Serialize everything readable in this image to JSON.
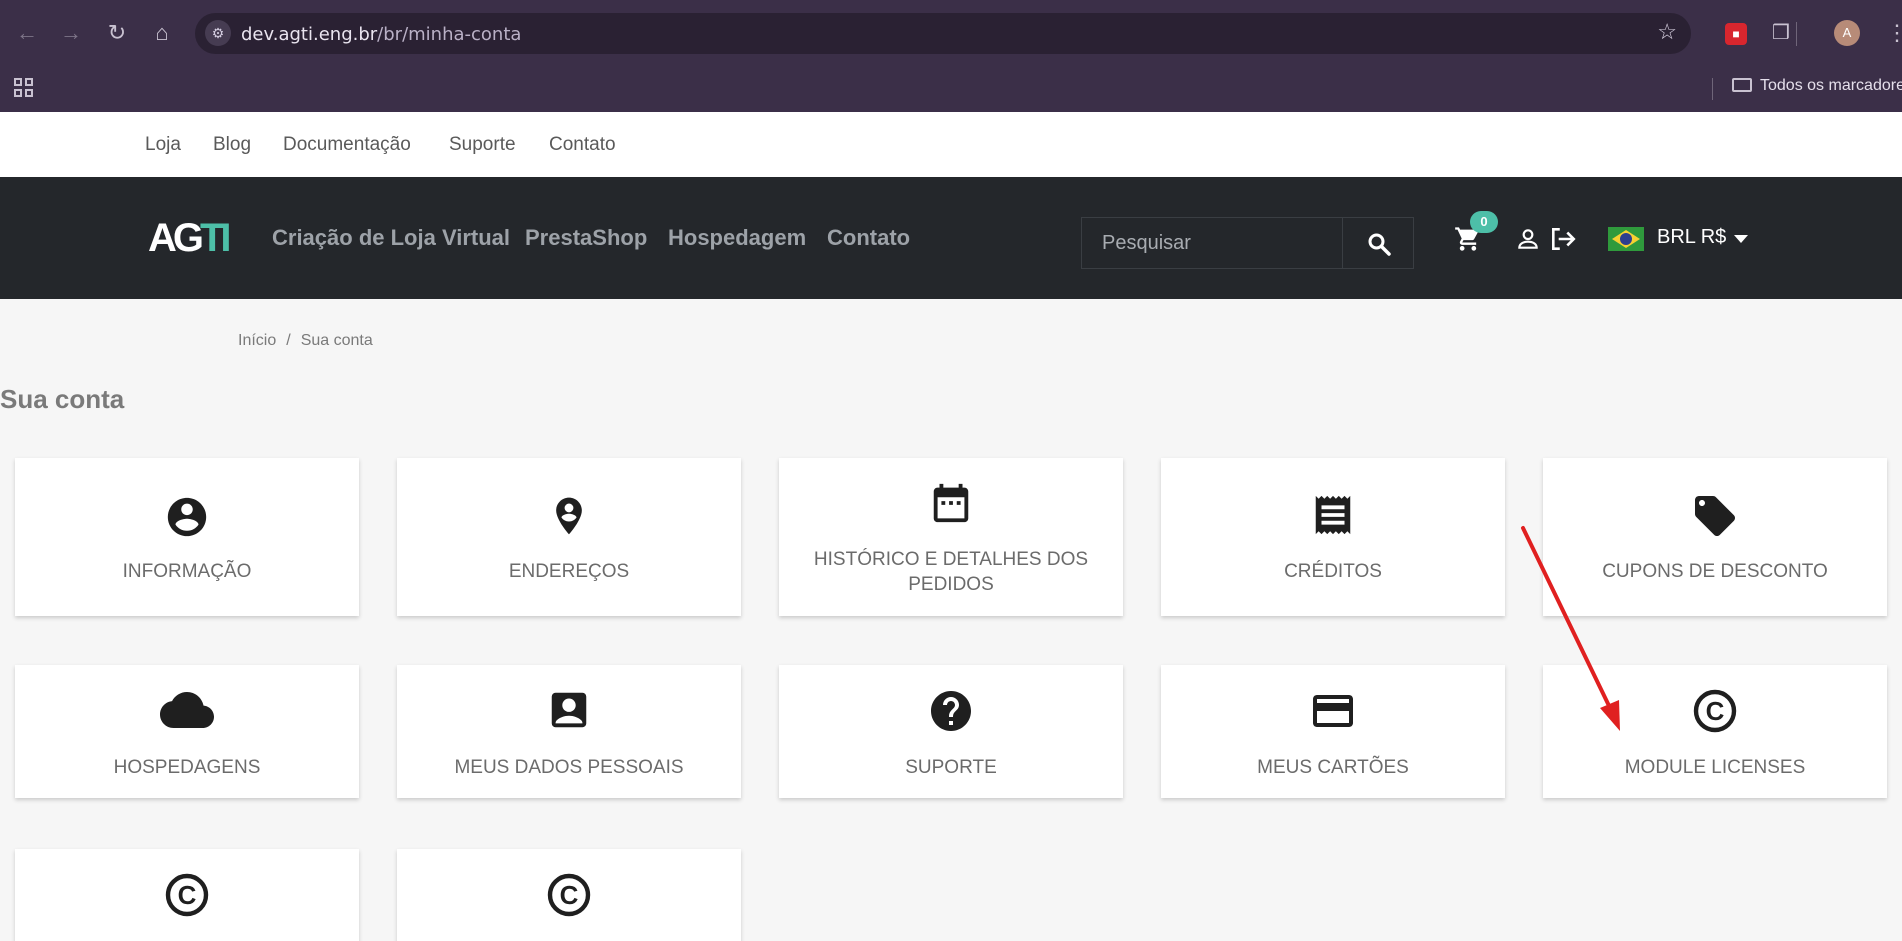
{
  "browser": {
    "url_domain": "dev.agti.eng.br",
    "url_path": "/br/minha-conta",
    "avatar_letter": "A",
    "bookmarks_folder": "Todos os marcadores",
    "icons": [
      "back-icon",
      "forward-icon",
      "reload-icon",
      "home-icon",
      "site-settings-icon",
      "star-icon",
      "extension-icon",
      "puzzle-icon",
      "kebab-menu-icon",
      "apps-grid-icon",
      "folder-icon"
    ]
  },
  "top_links": [
    "Loja",
    "Blog",
    "Documentação",
    "Suporte",
    "Contato"
  ],
  "header": {
    "logo_white": "AG",
    "logo_green": "TI",
    "nav": [
      "Criação de Loja Virtual",
      "PrestaShop",
      "Hospedagem",
      "Contato"
    ],
    "search_placeholder": "Pesquisar",
    "cart_count": "0",
    "currency": "BRL R$",
    "accent": "#4dbfa8"
  },
  "breadcrumb": [
    "Início",
    "/",
    "Sua conta"
  ],
  "page_title": "Sua conta",
  "cards": [
    {
      "label": "INFORMAÇÃO",
      "icon": "account-circle-icon"
    },
    {
      "label": "ENDEREÇOS",
      "icon": "location-pin-icon"
    },
    {
      "label": "HISTÓRICO E DETALHES DOS PEDIDOS",
      "icon": "calendar-icon"
    },
    {
      "label": "CRÉDITOS",
      "icon": "receipt-icon"
    },
    {
      "label": "CUPONS DE DESCONTO",
      "icon": "tag-icon"
    },
    {
      "label": "HOSPEDAGENS",
      "icon": "cloud-icon"
    },
    {
      "label": "MEUS DADOS PESSOAIS",
      "icon": "contact-card-icon"
    },
    {
      "label": "SUPORTE",
      "icon": "help-circle-icon"
    },
    {
      "label": "MEUS CARTÕES",
      "icon": "credit-card-icon"
    },
    {
      "label": "MODULE LICENSES",
      "icon": "copyright-icon"
    },
    {
      "label": "",
      "icon": "copyright-icon"
    },
    {
      "label": "",
      "icon": "copyright-icon"
    }
  ],
  "annotation_arrow_color": "#e02020"
}
